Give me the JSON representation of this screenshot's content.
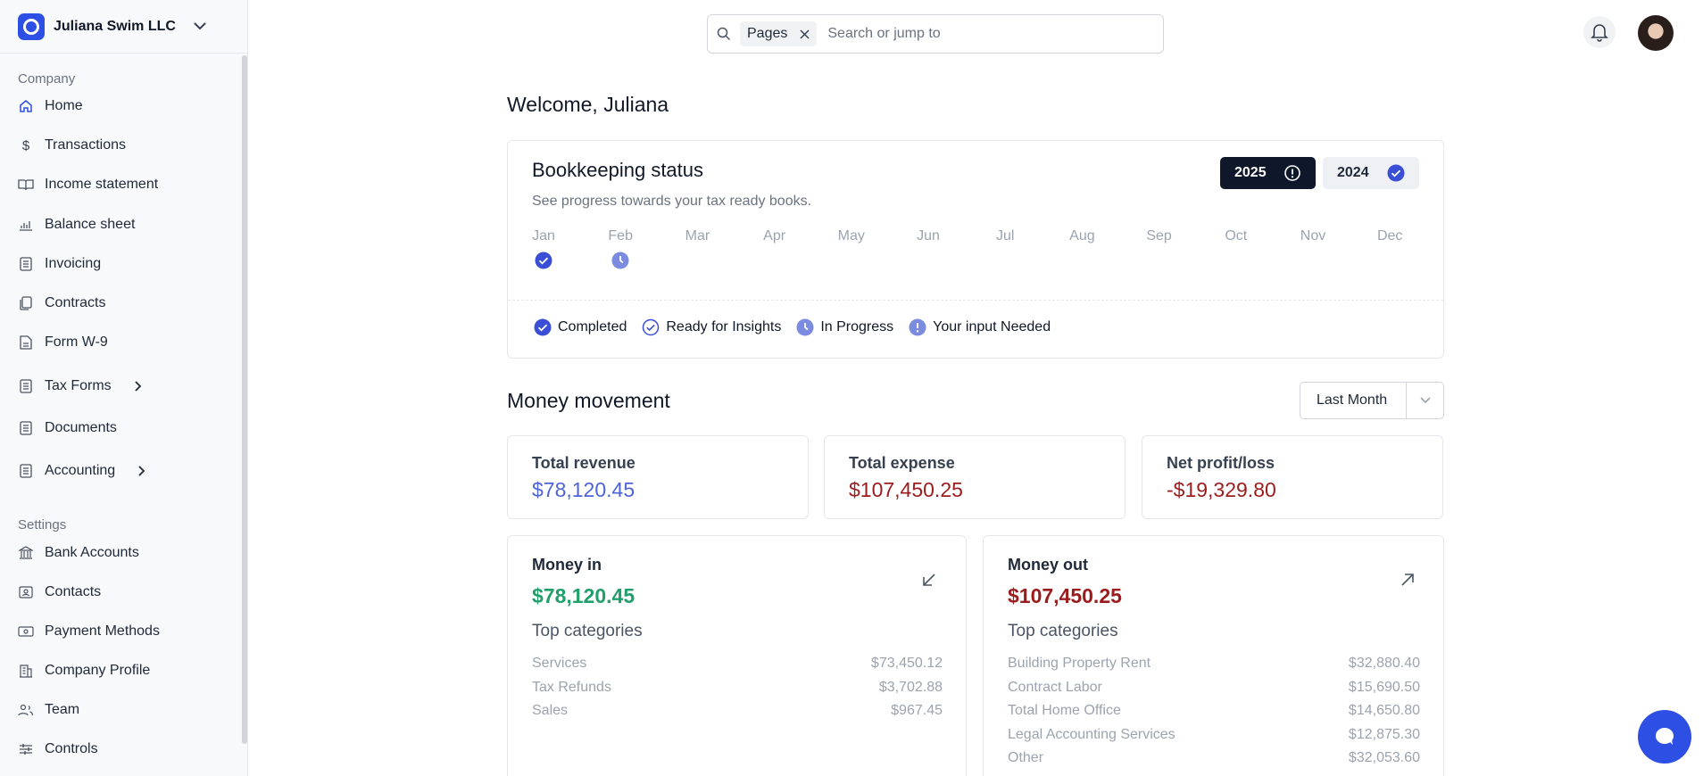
{
  "company": {
    "name": "Juliana Swim LLC"
  },
  "sidebar": {
    "company_section": "Company",
    "company_items": [
      {
        "label": "Home",
        "icon": "home-icon"
      },
      {
        "label": "Transactions",
        "icon": "dollar-icon"
      },
      {
        "label": "Income statement",
        "icon": "book-icon"
      },
      {
        "label": "Balance sheet",
        "icon": "chart-icon"
      },
      {
        "label": "Invoicing",
        "icon": "list-icon"
      },
      {
        "label": "Contracts",
        "icon": "copy-icon"
      },
      {
        "label": "Form W-9",
        "icon": "file-icon"
      },
      {
        "label": "Tax Forms",
        "icon": "list-icon",
        "expandable": true
      },
      {
        "label": "Documents",
        "icon": "list-icon"
      },
      {
        "label": "Accounting",
        "icon": "list-icon",
        "expandable": true
      }
    ],
    "settings_section": "Settings",
    "settings_items": [
      {
        "label": "Bank Accounts",
        "icon": "bank-icon"
      },
      {
        "label": "Contacts",
        "icon": "contact-icon"
      },
      {
        "label": "Payment Methods",
        "icon": "money-icon"
      },
      {
        "label": "Company Profile",
        "icon": "building-icon"
      },
      {
        "label": "Team",
        "icon": "team-icon"
      },
      {
        "label": "Controls",
        "icon": "sliders-icon"
      }
    ]
  },
  "search": {
    "chip": "Pages",
    "placeholder": "Search or jump to"
  },
  "welcome": "Welcome, Juliana",
  "bookkeeping": {
    "title": "Bookkeeping status",
    "subtitle": "See progress towards your tax ready books.",
    "years": [
      "2025",
      "2024"
    ],
    "months": [
      "Jan",
      "Feb",
      "Mar",
      "Apr",
      "May",
      "Jun",
      "Jul",
      "Aug",
      "Sep",
      "Oct",
      "Nov",
      "Dec"
    ],
    "month_status": {
      "Jan": "completed",
      "Feb": "in-progress"
    },
    "legend": [
      {
        "label": "Completed",
        "icon": "completed-icon"
      },
      {
        "label": "Ready for Insights",
        "icon": "ready-icon"
      },
      {
        "label": "In Progress",
        "icon": "in-progress-icon"
      },
      {
        "label": "Your input Needed",
        "icon": "input-needed-icon"
      }
    ]
  },
  "money_movement": {
    "title": "Money movement",
    "period": "Last Month",
    "stats": [
      {
        "label": "Total revenue",
        "value": "$78,120.45",
        "color": "#4f63d9"
      },
      {
        "label": "Total expense",
        "value": "$107,450.25",
        "color": "#9b1c1c"
      },
      {
        "label": "Net profit/loss",
        "value": "-$19,329.80",
        "color": "#9b1c1c"
      }
    ],
    "money_in": {
      "title": "Money in",
      "value": "$78,120.45",
      "color": "#22a06b",
      "top_categories_label": "Top categories",
      "categories": [
        {
          "name": "Services",
          "amount": "$73,450.12"
        },
        {
          "name": "Tax Refunds",
          "amount": "$3,702.88"
        },
        {
          "name": "Sales",
          "amount": "$967.45"
        }
      ]
    },
    "money_out": {
      "title": "Money out",
      "value": "$107,450.25",
      "color": "#9b1c1c",
      "top_categories_label": "Top categories",
      "categories": [
        {
          "name": "Building Property Rent",
          "amount": "$32,880.40"
        },
        {
          "name": "Contract Labor",
          "amount": "$15,690.50"
        },
        {
          "name": "Total Home Office",
          "amount": "$14,650.80"
        },
        {
          "name": "Legal Accounting Services",
          "amount": "$12,875.30"
        },
        {
          "name": "Other",
          "amount": "$32,053.60"
        }
      ]
    }
  },
  "colors": {
    "accent": "#2d4fe3",
    "status_blue": "#3a4fd6",
    "status_light": "#7b8be0",
    "dark": "#0f172a"
  }
}
